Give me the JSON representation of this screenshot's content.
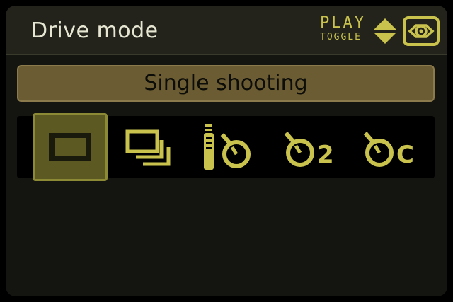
{
  "header": {
    "title": "Drive mode",
    "play_label": "PLAY",
    "toggle_label": "TOGGLE"
  },
  "selected_mode": {
    "label": "Single shooting"
  },
  "drive_modes": [
    {
      "icon": "single-shooting-icon",
      "selected": true
    },
    {
      "icon": "continuous-shooting-icon",
      "selected": false
    },
    {
      "icon": "remote-self-timer-icon",
      "selected": false
    },
    {
      "icon": "self-timer-2s-icon",
      "selected": false,
      "suffix": "2"
    },
    {
      "icon": "self-timer-continuous-icon",
      "selected": false,
      "suffix": "C"
    }
  ],
  "colors": {
    "accent": "#c9c34e",
    "banner": "#6b5c33",
    "selected_bg": "#5c5a22"
  }
}
